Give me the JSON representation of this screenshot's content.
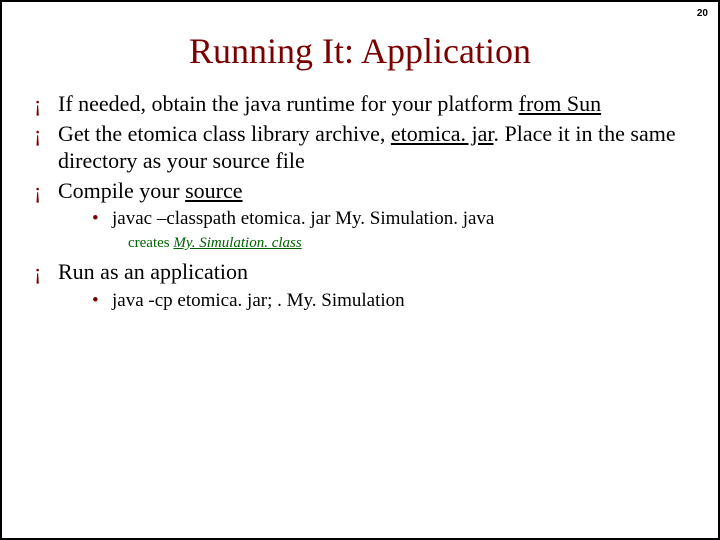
{
  "page_number": "20",
  "title": "Running It: Application",
  "bullets": {
    "b1_a": "If needed, obtain the java runtime for your platform ",
    "b1_link": "from Sun",
    "b2_a": "Get the etomica class library archive, ",
    "b2_link": "etomica. jar",
    "b2_b": ".  Place it in the same directory as your source file",
    "b3_a": "Compile your ",
    "b3_link": "source",
    "b4": "Run as an application"
  },
  "sub": {
    "s1": "javac –classpath etomica. jar My. Simulation. java",
    "s2": "java  -cp etomica. jar; . My. Simulation"
  },
  "note": {
    "prefix": "creates ",
    "file": "My. Simulation. class"
  }
}
